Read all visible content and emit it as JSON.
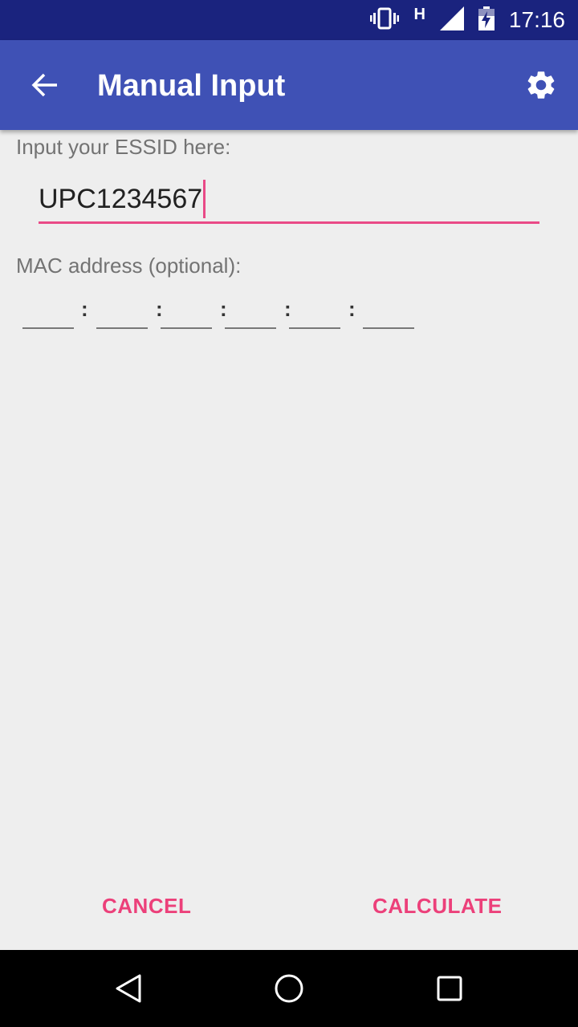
{
  "status_bar": {
    "time": "17:16",
    "network_type": "H",
    "icons": [
      "vibrate-icon",
      "signal-icon",
      "battery-charging-icon"
    ]
  },
  "app_bar": {
    "title": "Manual Input",
    "back_icon": "arrow-back-icon",
    "settings_icon": "gear-icon"
  },
  "form": {
    "essid_label": "Input your ESSID here:",
    "essid_value": "UPC1234567",
    "mac_label": "MAC address (optional):",
    "mac_separator": ":",
    "mac_segments": [
      "",
      "",
      "",
      "",
      "",
      ""
    ]
  },
  "actions": {
    "cancel_label": "CANCEL",
    "calculate_label": "CALCULATE"
  },
  "colors": {
    "status_bar": "#1a237e",
    "app_bar": "#3f51b5",
    "accent": "#ec407a",
    "background": "#eeeeee"
  }
}
